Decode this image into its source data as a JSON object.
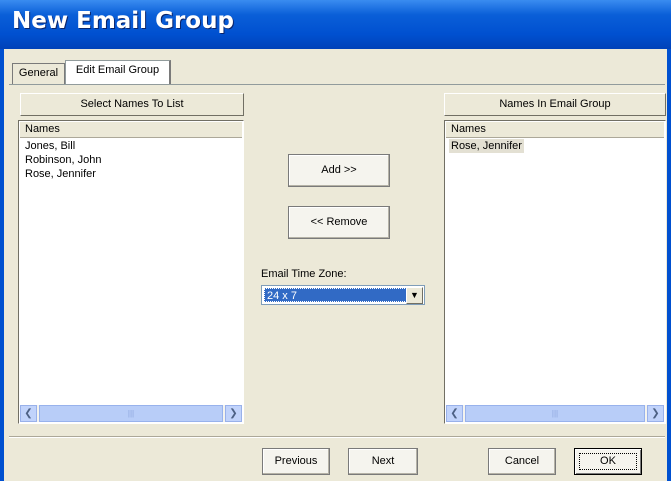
{
  "window": {
    "title": "New Email Group"
  },
  "tabs": [
    {
      "label": "General",
      "active": false
    },
    {
      "label": "Edit Email Group",
      "active": true
    }
  ],
  "left_panel": {
    "header": "Select Names To List",
    "column": "Names",
    "items": [
      "Jones, Bill",
      "Robinson, John",
      "Rose, Jennifer"
    ]
  },
  "right_panel": {
    "header": "Names In Email Group",
    "column": "Names",
    "items": [
      "Rose, Jennifer"
    ]
  },
  "actions": {
    "add": "Add >>",
    "remove": "<< Remove"
  },
  "timezone": {
    "label": "Email Time Zone:",
    "value": "24 x 7"
  },
  "footer": {
    "previous": "Previous",
    "next": "Next",
    "cancel": "Cancel",
    "ok": "OK"
  },
  "icons": {
    "scroll_left": "chevron-left-icon",
    "scroll_right": "chevron-right-icon",
    "dropdown": "chevron-down-icon"
  }
}
